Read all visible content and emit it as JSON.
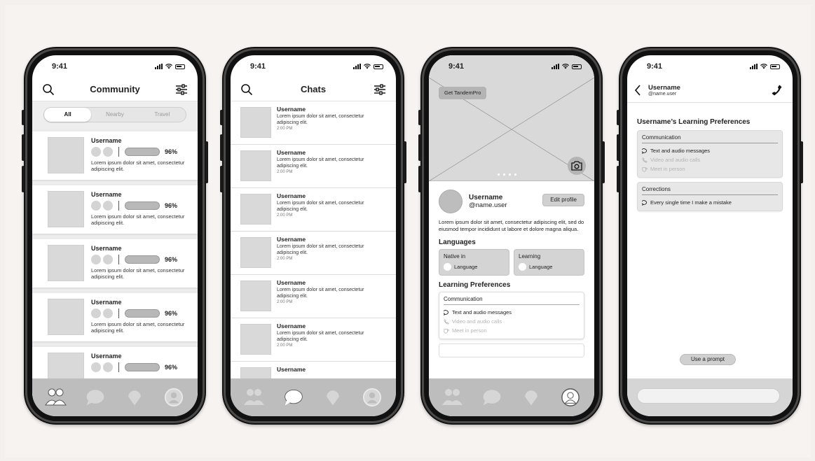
{
  "status": {
    "time": "9:41"
  },
  "community": {
    "title": "Community",
    "segments": [
      "All",
      "Nearby",
      "Travel"
    ],
    "cards": [
      {
        "name": "Username",
        "percent": "96%",
        "text": "Lorem ipsum dolor sit amet, consectetur adipiscing elit."
      },
      {
        "name": "Username",
        "percent": "96%",
        "text": "Lorem ipsum dolor sit amet, consectetur adipiscing elit."
      },
      {
        "name": "Username",
        "percent": "96%",
        "text": "Lorem ipsum dolor sit amet, consectetur adipiscing elit."
      },
      {
        "name": "Username",
        "percent": "96%",
        "text": "Lorem ipsum dolor sit amet, consectetur adipiscing elit."
      },
      {
        "name": "Username",
        "percent": "96%",
        "text": ""
      }
    ]
  },
  "chats": {
    "title": "Chats",
    "rows": [
      {
        "name": "Username",
        "msg": "Lorem ipsum dolor sit amet, consectetur adipiscing elit.",
        "time": "2:00 PM"
      },
      {
        "name": "Username",
        "msg": "Lorem ipsum dolor sit amet, consectetur adipiscing elit.",
        "time": "2:00 PM"
      },
      {
        "name": "Username",
        "msg": "Lorem ipsum dolor sit amet, consectetur adipiscing elit.",
        "time": "2:00 PM"
      },
      {
        "name": "Username",
        "msg": "Lorem ipsum dolor sit amet, consectetur adipiscing elit.",
        "time": "2:00 PM"
      },
      {
        "name": "Username",
        "msg": "Lorem ipsum dolor sit amet, consectetur adipiscing elit.",
        "time": "2:00 PM"
      },
      {
        "name": "Username",
        "msg": "Lorem ipsum dolor sit amet, consectetur adipiscing elit.",
        "time": "2:00 PM"
      },
      {
        "name": "Username",
        "msg": "",
        "time": ""
      }
    ]
  },
  "profile": {
    "get_pro": "Get TandemPro",
    "name": "Username",
    "handle": "@name.user",
    "edit": "Edit profile",
    "bio": "Lorem ipsum dolor sit amet, consectetur adipiscing elit, sed do eiusmod tempor incididunt ut labore et dolore magna aliqua.",
    "languages_title": "Languages",
    "native_label": "Native in",
    "native_value": "Language",
    "learning_label": "Learning",
    "learning_value": "Language",
    "prefs_title": "Learning Preferences",
    "comm_title": "Communication",
    "pref1": "Text and audio messages",
    "pref2": "Video and audio calls",
    "pref3": "Meet in person"
  },
  "chat_detail": {
    "name": "Username",
    "handle": "@name.user",
    "title": "Username’s Learning Preferences",
    "comm_title": "Communication",
    "pref1": "Text and audio messages",
    "pref2": "Video and audio calls",
    "pref3": "Meet in person",
    "corr_title": "Corrections",
    "corr1": "Every single time I make a mistake",
    "prompt": "Use a prompt"
  }
}
